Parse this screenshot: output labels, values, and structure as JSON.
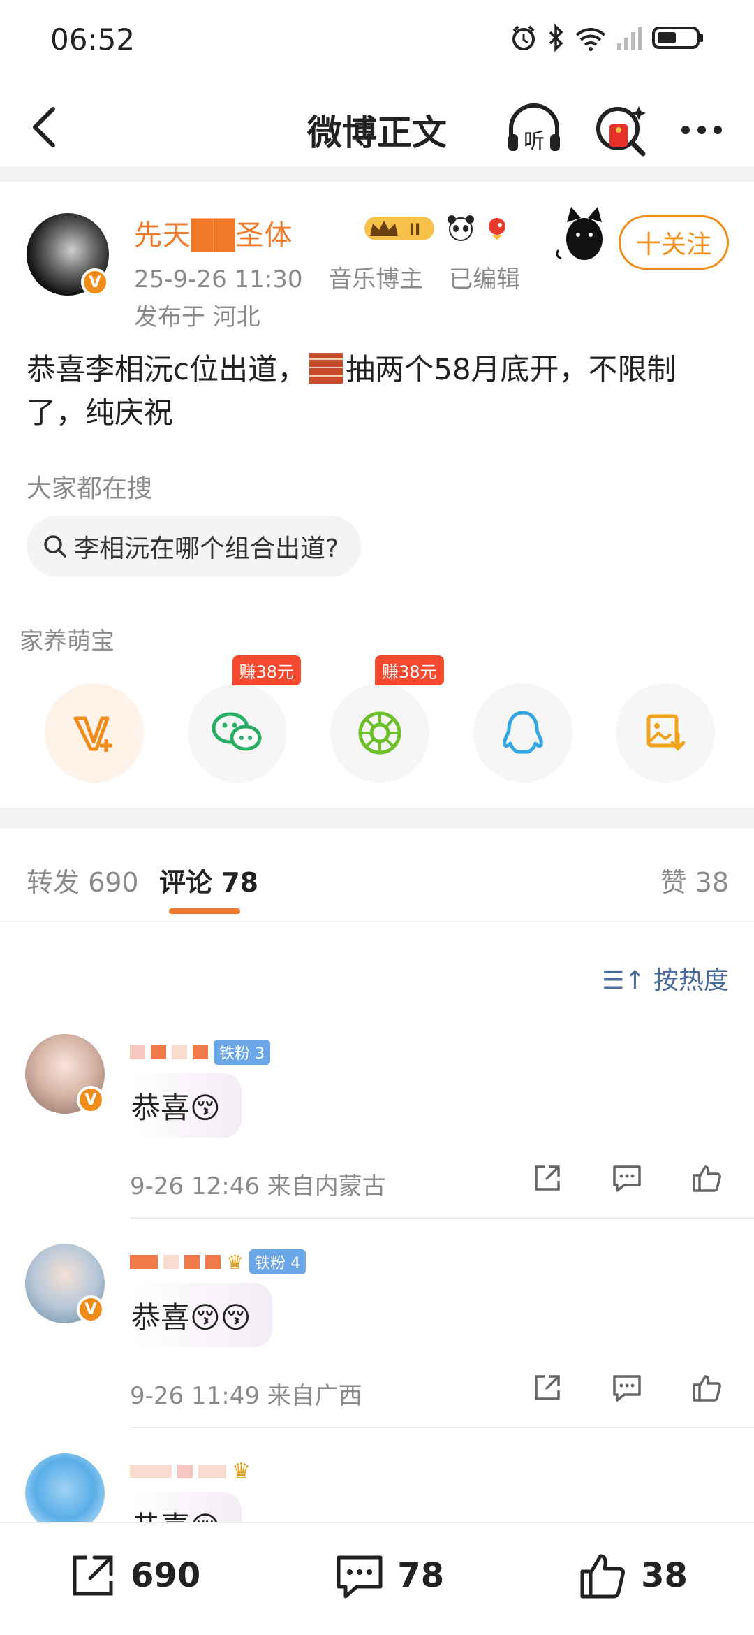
{
  "status": {
    "time": "06:52"
  },
  "topbar": {
    "title": "微博正文",
    "listen_label": "听"
  },
  "post": {
    "author": "先天██圣体",
    "level_badge": "II",
    "date": "25-9-26 11:30",
    "role": "音乐博主",
    "edited": "已编辑",
    "location": "发布于 河北",
    "follow_label": "十关注",
    "text_before": "恭喜李相沅c位出道，",
    "text_after": "抽两个58月底开，不限制了，纯庆祝",
    "search_label": "大家都在搜",
    "search_query": "李相沅在哪个组合出道?",
    "home_label": "家养萌宝",
    "share_earn_1": "赚38元",
    "share_earn_2": "赚38元"
  },
  "tabs": {
    "repost": "转发 690",
    "comments": "评论 78",
    "likes": "赞 38"
  },
  "sort_label": "按热度",
  "comments": [
    {
      "fan": "铁粉 3",
      "text": "恭喜😚",
      "time": "9-26 12:46",
      "location": "来自内蒙古"
    },
    {
      "fan": "铁粉 4",
      "text": "恭喜😚😚",
      "time": "9-26 11:49",
      "location": "来自广西"
    },
    {
      "text": "恭喜😚"
    }
  ],
  "bottom": {
    "reposts": "690",
    "comments": "78",
    "likes": "38"
  },
  "colors": {
    "accent": "#f07a2a",
    "follow": "#f08d1a",
    "earn": "#f54a2f",
    "fan_badge": "#6aa6e8"
  }
}
